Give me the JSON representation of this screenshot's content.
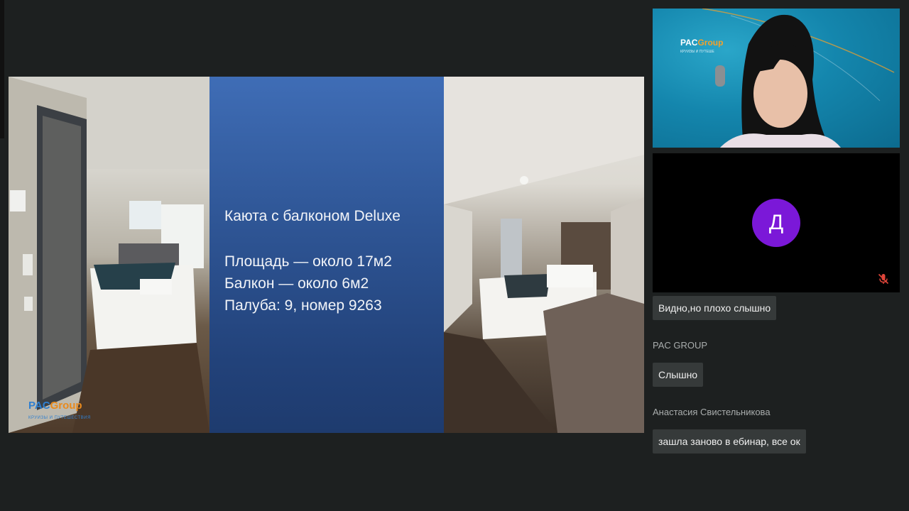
{
  "slide": {
    "title": "Каюта с балконом Deluxe",
    "lines": [
      "Площадь — около 17м2",
      "Балкон — около 6м2",
      "Палуба: 9, номер 9263"
    ],
    "logo": {
      "main": "PAC",
      "accent": "Group",
      "sub": "КРУИЗЫ И ПУТЕШЕСТВИЯ"
    }
  },
  "video_tiles": {
    "presenter": {
      "logo_main": "PAC",
      "logo_accent": "Group",
      "logo_sub": "КРУИЗЫ И ПУТЕШЕ"
    },
    "participant": {
      "avatar_initial": "Д",
      "avatar_color": "#7b18d8",
      "mic_status": "muted"
    }
  },
  "chat": {
    "messages": [
      {
        "sender": "",
        "text": "Видно,но плохо слышно"
      },
      {
        "sender": "PAC GROUP",
        "text": "Слышно"
      },
      {
        "sender": "Анастасия Свистельникова",
        "text": "зашла заново в ебинар, все ок"
      }
    ]
  },
  "colors": {
    "background": "#1d2020",
    "bubble": "#363a3a",
    "slide_blue": "#2f5696",
    "mic_off_red": "#e0453a"
  }
}
